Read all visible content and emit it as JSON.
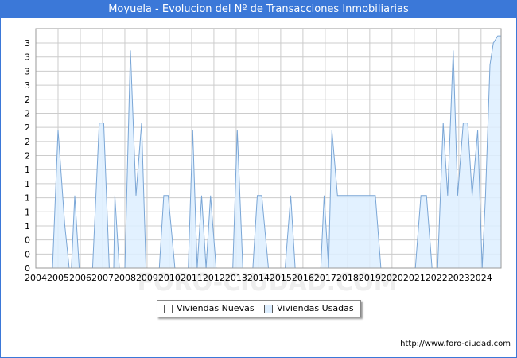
{
  "page": {
    "title": "Moyuela - Evolucion del Nº de Transacciones Inmobiliarias",
    "footer_url": "http://www.foro-ciudad.com",
    "watermark": "FORO-CIUDAD.COM"
  },
  "colors": {
    "title_bar": "#3b78d8",
    "nuevas_fill": "#ffffff",
    "usadas_fill": "#ddeeff",
    "usadas_line": "#7aa6d6",
    "grid": "#cccccc"
  },
  "chart_data": {
    "type": "area",
    "title": "Moyuela - Evolucion del Nº de Transacciones Inmobiliarias",
    "xlabel": "",
    "ylabel": "",
    "x_ticks": [
      "2004",
      "2005",
      "2006",
      "2007",
      "2008",
      "2009",
      "2010",
      "2011",
      "2012",
      "2013",
      "2014",
      "2015",
      "2016",
      "2017",
      "2018",
      "2019",
      "2020",
      "2021",
      "2022",
      "2023",
      "2024"
    ],
    "y_ticks": [
      "0",
      "0",
      "0",
      "1",
      "1",
      "1",
      "1",
      "1",
      "2",
      "2",
      "2",
      "2",
      "2",
      "3",
      "3",
      "3",
      "3"
    ],
    "ylim": [
      0,
      3.3
    ],
    "xlim": [
      2004,
      2024.9
    ],
    "grid": true,
    "legend_position": "bottom-center",
    "series": [
      {
        "name": "Viviendas Nuevas",
        "points": []
      },
      {
        "name": "Viviendas Usadas",
        "points": [
          [
            2004.75,
            0
          ],
          [
            2005.0,
            1.9
          ],
          [
            2005.3,
            0.6
          ],
          [
            2005.5,
            0
          ],
          [
            2005.6,
            0
          ],
          [
            2005.75,
            1.0
          ],
          [
            2005.95,
            0
          ],
          [
            2006.55,
            0
          ],
          [
            2006.85,
            2.0
          ],
          [
            2007.05,
            2.0
          ],
          [
            2007.3,
            0
          ],
          [
            2007.5,
            0
          ],
          [
            2007.55,
            1.0
          ],
          [
            2007.75,
            0
          ],
          [
            2008.0,
            0
          ],
          [
            2008.25,
            3.0
          ],
          [
            2008.5,
            1.0
          ],
          [
            2008.75,
            2.0
          ],
          [
            2008.95,
            0
          ],
          [
            2009.55,
            0
          ],
          [
            2009.75,
            1.0
          ],
          [
            2009.95,
            1.0
          ],
          [
            2010.25,
            0
          ],
          [
            2010.85,
            0
          ],
          [
            2011.05,
            1.9
          ],
          [
            2011.25,
            0
          ],
          [
            2011.45,
            1.0
          ],
          [
            2011.65,
            0
          ],
          [
            2011.85,
            1.0
          ],
          [
            2012.1,
            0
          ],
          [
            2012.85,
            0
          ],
          [
            2013.05,
            1.9
          ],
          [
            2013.3,
            0
          ],
          [
            2013.75,
            0
          ],
          [
            2013.95,
            1.0
          ],
          [
            2014.15,
            1.0
          ],
          [
            2014.45,
            0
          ],
          [
            2015.2,
            0
          ],
          [
            2015.45,
            1.0
          ],
          [
            2015.65,
            0
          ],
          [
            2016.8,
            0
          ],
          [
            2016.95,
            1.0
          ],
          [
            2017.15,
            0
          ],
          [
            2017.3,
            1.9
          ],
          [
            2017.55,
            1.0
          ],
          [
            2019.25,
            1.0
          ],
          [
            2019.5,
            0
          ],
          [
            2021.05,
            0
          ],
          [
            2021.3,
            1.0
          ],
          [
            2021.55,
            1.0
          ],
          [
            2021.8,
            0
          ],
          [
            2022.05,
            0
          ],
          [
            2022.3,
            2.0
          ],
          [
            2022.5,
            1.0
          ],
          [
            2022.75,
            3.0
          ],
          [
            2022.95,
            1.0
          ],
          [
            2023.2,
            2.0
          ],
          [
            2023.4,
            2.0
          ],
          [
            2023.6,
            1.0
          ],
          [
            2023.85,
            1.9
          ],
          [
            2024.05,
            0
          ],
          [
            2024.2,
            1.0
          ],
          [
            2024.4,
            2.8
          ],
          [
            2024.55,
            3.1
          ],
          [
            2024.75,
            3.2
          ],
          [
            2024.9,
            3.2
          ]
        ]
      }
    ]
  }
}
